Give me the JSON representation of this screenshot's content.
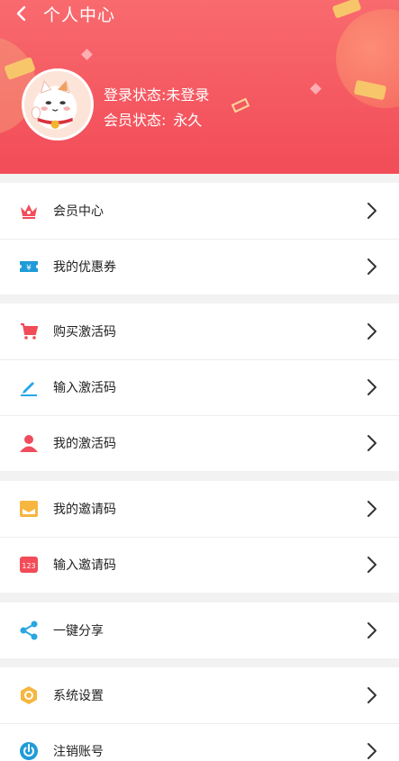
{
  "header": {
    "title": "个人中心",
    "login_status_label": "登录状态:",
    "login_status_value": "未登录",
    "member_status_label": "会员状态:",
    "member_status_value": "永久",
    "gradient_top": "#f86a6e",
    "gradient_bottom": "#f24c58"
  },
  "menu": {
    "section1": [
      {
        "label": "会员中心",
        "icon": "crown-icon",
        "color": "#f24c58"
      },
      {
        "label": "我的优惠券",
        "icon": "coupon-icon",
        "color": "#1f9bd8"
      }
    ],
    "section2": [
      {
        "label": "购买激活码",
        "icon": "cart-icon",
        "color": "#f24c58"
      },
      {
        "label": "输入激活码",
        "icon": "pencil-icon",
        "color": "#26a7e8"
      },
      {
        "label": "我的激活码",
        "icon": "user-icon",
        "color": "#ef4d5f"
      }
    ],
    "section3": [
      {
        "label": "我的邀请码",
        "icon": "envelope-icon",
        "color": "#f6b640"
      },
      {
        "label": "输入邀请码",
        "icon": "number-code-icon",
        "color": "#f24c58"
      }
    ],
    "section4": [
      {
        "label": "一键分享",
        "icon": "share-icon",
        "color": "#2aa6e0"
      }
    ],
    "section5": [
      {
        "label": "系统设置",
        "icon": "settings-icon",
        "color": "#f6b640"
      },
      {
        "label": "注销账号",
        "icon": "power-icon",
        "color": "#1f9bd8"
      }
    ]
  }
}
